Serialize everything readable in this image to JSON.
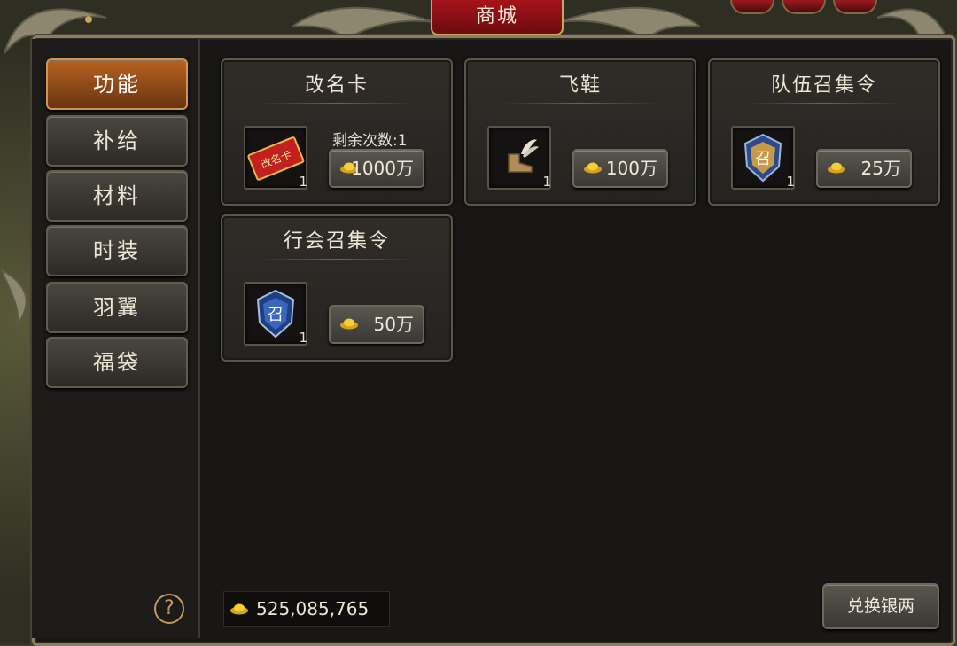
{
  "window": {
    "title": "商城"
  },
  "sidebar": {
    "items": [
      {
        "label": "功能",
        "active": true
      },
      {
        "label": "补给",
        "active": false
      },
      {
        "label": "材料",
        "active": false
      },
      {
        "label": "时装",
        "active": false
      },
      {
        "label": "羽翼",
        "active": false
      },
      {
        "label": "福袋",
        "active": false
      }
    ],
    "help_glyph": "?"
  },
  "items": [
    {
      "name": "改名卡",
      "count": "1",
      "price": "1000万",
      "remaining": "剩余次数:1",
      "icon": "rename-card-icon",
      "icon_text": "改名卡"
    },
    {
      "name": "飞鞋",
      "count": "1",
      "price": "100万",
      "icon": "winged-boot-icon"
    },
    {
      "name": "队伍召集令",
      "count": "1",
      "price": "25万",
      "icon": "team-summon-token-icon",
      "icon_text": "召"
    },
    {
      "name": "行会召集令",
      "count": "1",
      "price": "50万",
      "icon": "guild-summon-token-icon",
      "icon_text": "召"
    }
  ],
  "footer": {
    "balance": "525,085,765",
    "exchange_label": "兑换银两"
  },
  "colors": {
    "active_tab": "#b8621f",
    "title_bg": "#a5141a",
    "gold": "#f2c12e"
  }
}
